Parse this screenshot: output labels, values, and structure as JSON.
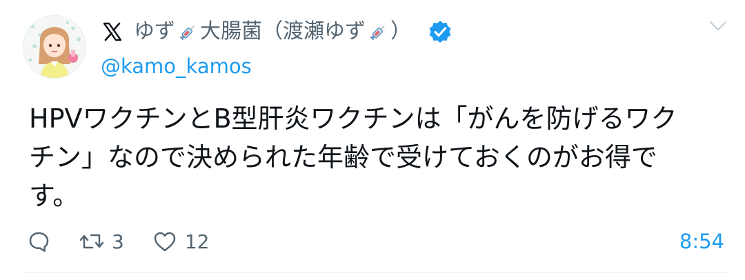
{
  "tweet": {
    "author": {
      "display_name_part1": "ゆず",
      "display_name_part2": "大腸菌（渡瀬ゆず",
      "display_name_part3": "）",
      "handle": "@kamo_kamos",
      "verified": true,
      "platform_icon": "x-logo-icon",
      "avatar_icon": "anime-girl-avatar-icon"
    },
    "text_lines": [
      "HPVワクチンとB型肝炎ワクチンは「がんを防げるワク",
      "チン」なので決められた年齢で受けておくのがお得で",
      "す。"
    ],
    "actions": {
      "reply_icon": "reply-icon",
      "retweet_icon": "retweet-icon",
      "retweet_count": "3",
      "like_icon": "heart-icon",
      "like_count": "12"
    },
    "time": "8:54",
    "colors": {
      "accent": "#1d9bf0",
      "secondary_text": "#536471",
      "primary_text": "#0f1419"
    }
  }
}
